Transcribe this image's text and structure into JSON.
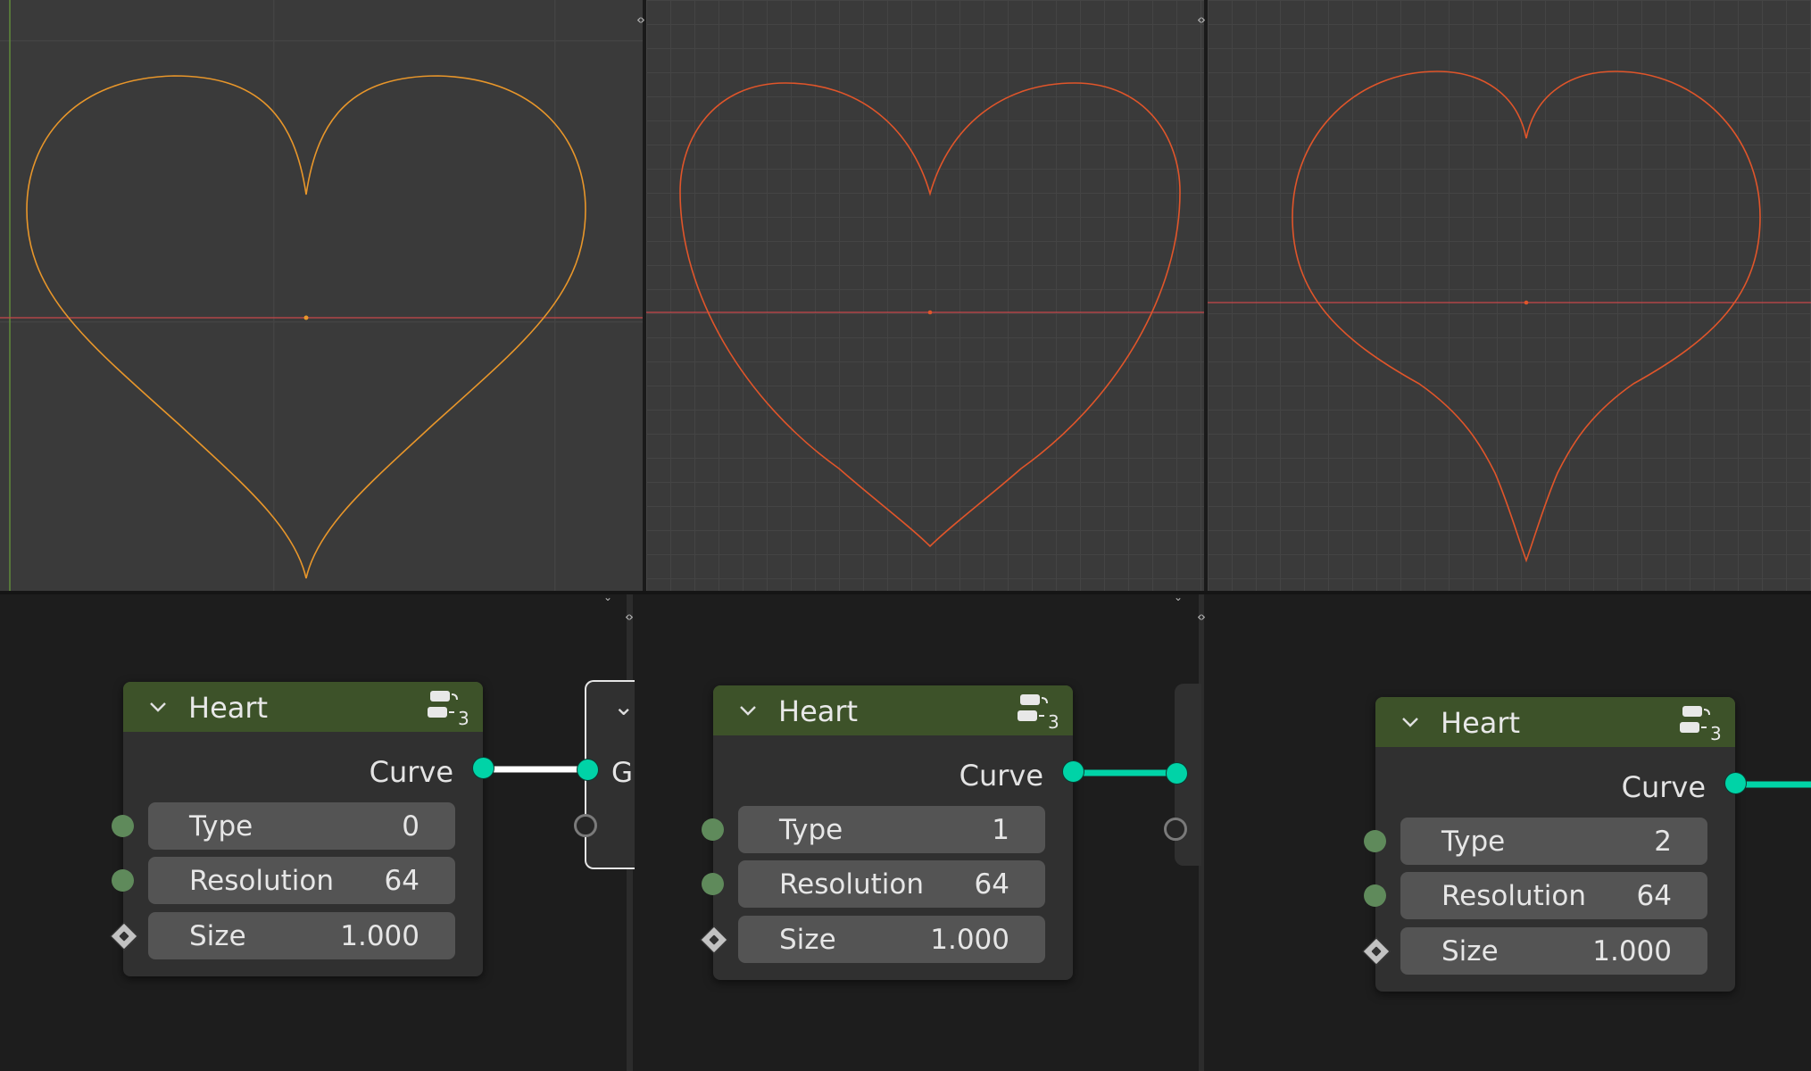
{
  "colors": {
    "viewport_bg": "#3a3a3a",
    "node_editor_bg": "#1d1d1d",
    "node_header": "#3d5229",
    "curve_socket": "#00d3a7",
    "int_socket": "#5f8a5b",
    "heart_curve_1": "#e8962a",
    "heart_curve_2_3": "#e0552a",
    "x_axis": "#c8474a",
    "selected_link": "#ffffff"
  },
  "nodes": [
    {
      "title": "Heart",
      "group_badge": "3",
      "output_label": "Curve",
      "fields": [
        {
          "label": "Type",
          "value": "0"
        },
        {
          "label": "Resolution",
          "value": "64"
        },
        {
          "label": "Size",
          "value": "1.000"
        }
      ]
    },
    {
      "title": "Heart",
      "group_badge": "3",
      "output_label": "Curve",
      "fields": [
        {
          "label": "Type",
          "value": "1"
        },
        {
          "label": "Resolution",
          "value": "64"
        },
        {
          "label": "Size",
          "value": "1.000"
        }
      ]
    },
    {
      "title": "Heart",
      "group_badge": "3",
      "output_label": "Curve",
      "fields": [
        {
          "label": "Type",
          "value": "2"
        },
        {
          "label": "Resolution",
          "value": "64"
        },
        {
          "label": "Size",
          "value": "1.000"
        }
      ]
    }
  ],
  "partial_node_label": "G",
  "icons": {
    "area_split": "area-split-icon",
    "collapse": "chevron-down-icon",
    "node_group": "node-group-icon",
    "link_drag": "link-drag-icon"
  }
}
